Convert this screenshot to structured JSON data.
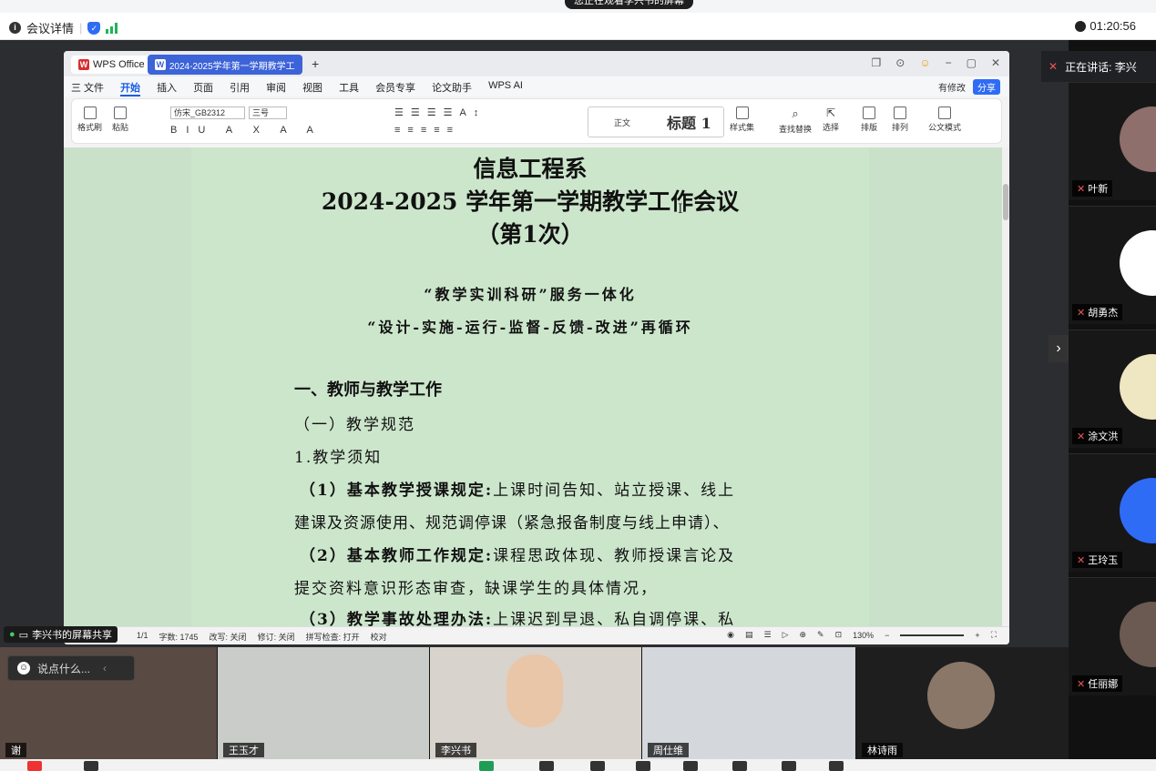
{
  "banner": {
    "message": "您正在观看李兴书的屏幕"
  },
  "meeting": {
    "details_label": "会议详情",
    "timer": "01:20:56"
  },
  "wps": {
    "tab_home": "WPS Office",
    "tab_doc": "2024-2025学年第一学期教学工...",
    "menu": [
      "三 文件",
      "开始",
      "插入",
      "页面",
      "引用",
      "审阅",
      "视图",
      "工具",
      "会员专享",
      "论文助手",
      "WPS AI"
    ],
    "active_menu": "开始",
    "modified_label": "有修改",
    "share_label": "分享",
    "font_name": "仿宋_GB2312",
    "font_size": "三号",
    "style_normal": "正文",
    "style_heading": "标题 1",
    "ribbon_left": [
      "格式刷",
      "粘贴"
    ],
    "ribbon_right": [
      "样式集",
      "查找替换",
      "选择",
      "排版",
      "排列",
      "公文模式"
    ]
  },
  "document": {
    "title1": "信息工程系",
    "title2": "2024-2025 学年第一学期教学工作会议",
    "title3": "（第1次）",
    "slogan1": "“教学实训科研”服务一体化",
    "slogan2": "“设计-实施-运行-监督-反馈-改进”再循环",
    "h1": "一、教师与教学工作",
    "h2": "（一）教学规范",
    "h3": "1.教学须知",
    "p1_bold": "（1）基本教学授课规定:",
    "p1_text": "上课时间告知、站立授课、线上",
    "p1_cont": "建课及资源使用、规范调停课（紧急报备制度与线上申请）、",
    "p2_bold": "（2）基本教师工作规定:",
    "p2_text": "课程思政体现、教师授课言论及",
    "p2_cont": "提交资料意识形态审查，缺课学生的具体情况，",
    "p3_bold": "（3）教学事故处理办法:",
    "p3_text": "上课迟到早退、私自调停课、私"
  },
  "statusbar": {
    "page": "1/1",
    "words": "字数: 1745",
    "rewrite": "改写: 关闭",
    "revise": "修订: 关闭",
    "spell": "拼写检查: 打开",
    "proof": "校对",
    "zoom": "130%"
  },
  "share": {
    "label": "李兴书的屏幕共享"
  },
  "chat": {
    "placeholder": "说点什么..."
  },
  "speaking": {
    "label": "正在讲话: 李兴"
  },
  "participants": [
    "叶新",
    "胡勇杰",
    "涂文洪",
    "王玲玉",
    "任丽娜"
  ],
  "video": {
    "names": [
      "谢",
      "王玉才",
      "李兴书",
      "周仕维",
      "林诗雨"
    ]
  },
  "colors": {
    "accent": "#2f6cf6",
    "doc_bg": "#cce6cc"
  }
}
